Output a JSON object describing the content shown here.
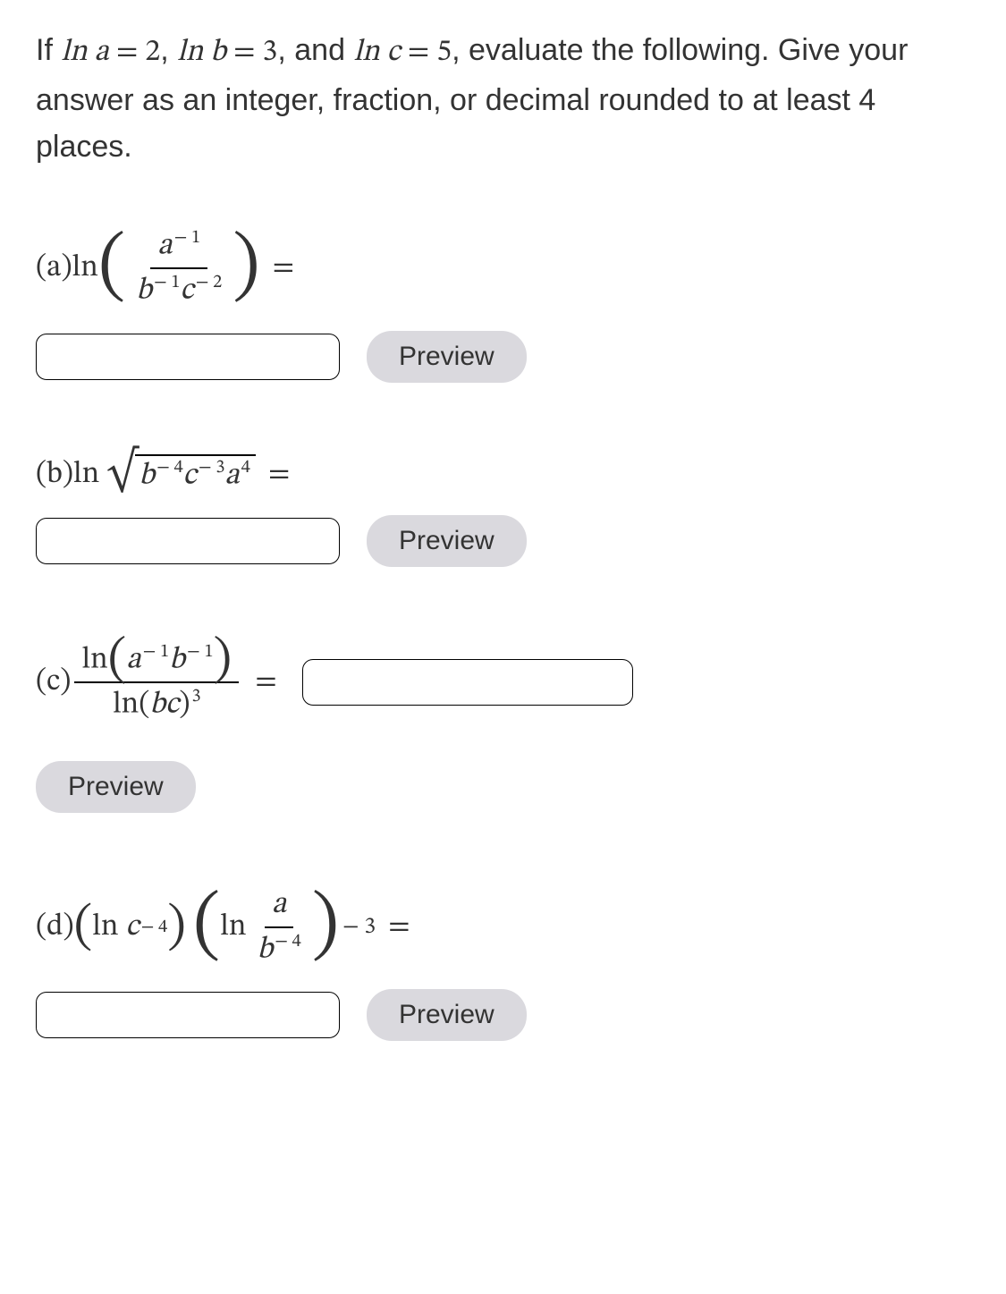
{
  "problem": {
    "prefix": "If ",
    "given1_lhs": "ln a",
    "given1_rhs": "2",
    "sep1": ", ",
    "given2_lhs": "ln b",
    "given2_rhs": "3",
    "sep2": ", and ",
    "given3_lhs": "ln c",
    "given3_rhs": "5",
    "suffix": ", evaluate the following. Give your answer as an integer, fraction, or decimal rounded to at least 4 places."
  },
  "parts": {
    "a": {
      "label": "(a) ",
      "ln": "ln",
      "num_base": "a",
      "num_exp": "− 1",
      "den_b": "b",
      "den_b_exp": "− 1",
      "den_c": "c",
      "den_c_exp": "− 2",
      "equals": "="
    },
    "b": {
      "label": "(b) ",
      "ln": "ln",
      "rad_b": "b",
      "rad_b_exp": "− 4",
      "rad_c": "c",
      "rad_c_exp": "− 3",
      "rad_a": "a",
      "rad_a_exp": "4",
      "equals": "="
    },
    "c": {
      "label": "(c) ",
      "num_ln": "ln",
      "num_a": "a",
      "num_a_exp": "− 1",
      "num_b": "b",
      "num_b_exp": "− 1",
      "den_ln": "ln",
      "den_bc": "bc",
      "den_exp": "3",
      "equals": "="
    },
    "d": {
      "label": "(d) ",
      "lnc": "ln",
      "c": "c",
      "c_exp": "− 4",
      "ln2": "ln",
      "frac_a": "a",
      "frac_b": "b",
      "frac_b_exp": "− 4",
      "outer_exp": "− 3",
      "equals": "="
    }
  },
  "buttons": {
    "preview": "Preview"
  },
  "inputs": {
    "a": "",
    "b": "",
    "c": "",
    "d": ""
  }
}
